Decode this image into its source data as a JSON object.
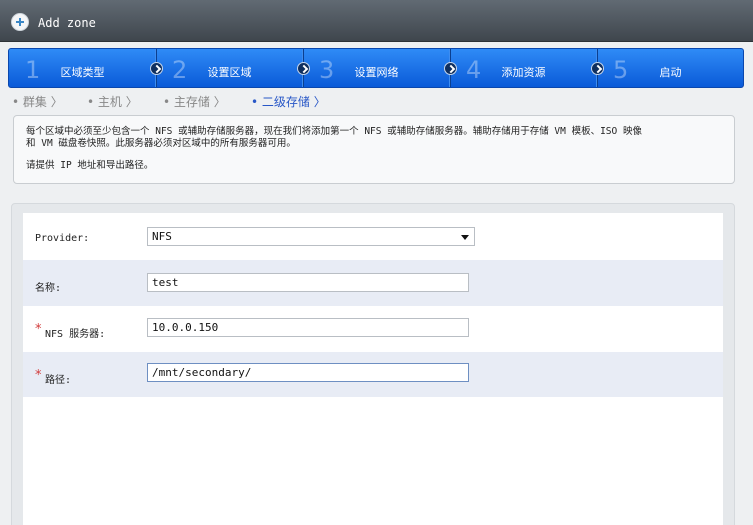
{
  "dialog": {
    "title": "Add zone",
    "icon": "plus-circle-icon"
  },
  "steps": [
    {
      "num": "1",
      "label": "区域类型"
    },
    {
      "num": "2",
      "label": "设置区域"
    },
    {
      "num": "3",
      "label": "设置网络"
    },
    {
      "num": "4",
      "label": "添加资源"
    },
    {
      "num": "5",
      "label": "启动"
    }
  ],
  "substeps": [
    {
      "label": "• 群集 〉"
    },
    {
      "label": "• 主机 〉"
    },
    {
      "label": "• 主存储 〉"
    },
    {
      "label": "• 二级存储 〉",
      "active": true
    }
  ],
  "description": {
    "line1": "每个区域中必须至少包含一个 NFS 或辅助存储服务器，现在我们将添加第一个 NFS 或辅助存储服务器。辅助存储用于存储 VM 模板、ISO 映像",
    "line2": "和 VM 磁盘卷快照。此服务器必须对区域中的所有服务器可用。",
    "line3": "请提供 IP 地址和导出路径。"
  },
  "form": {
    "provider": {
      "label": "Provider:",
      "value": "NFS"
    },
    "name": {
      "label": "名称:",
      "value": "test"
    },
    "nfs_server": {
      "label": "NFS 服务器:",
      "value": "10.0.0.150",
      "required_mark": "*"
    },
    "path": {
      "label": "路径:",
      "value": "/mnt/secondary/",
      "required_mark": "*"
    }
  },
  "colors": {
    "accent": "#1a6fe6",
    "required": "#d13b3b",
    "active_substep": "#2857c7"
  }
}
